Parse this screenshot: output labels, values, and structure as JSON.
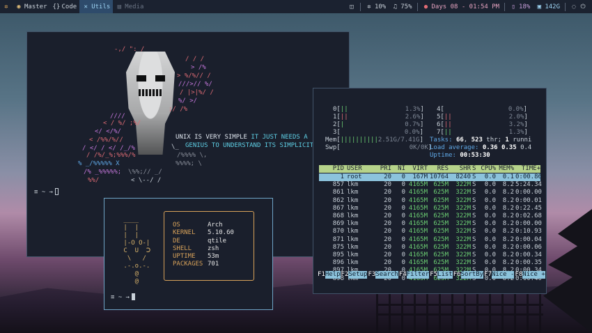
{
  "bar": {
    "workspaces": [
      {
        "icon": "compass-icon",
        "label": "Master",
        "active": false
      },
      {
        "icon": "code-braces-icon",
        "label": "Code",
        "active": false
      },
      {
        "icon": "wrench-icon",
        "label": "Utils",
        "active": true
      },
      {
        "icon": "film-icon",
        "label": "Media",
        "active": false
      }
    ],
    "cpu": "10%",
    "volume": "75%",
    "clock": "Days 08 - 01:54 PM",
    "mem": "18%",
    "disk": "142G"
  },
  "term1": {
    "quote_white1": "UNIX IS VERY SIMPLE",
    "quote_cyan1": "IT JUST NEEDS A",
    "quote_cyan2": "GENIUS TO UNDERSTAND ITS SIMPLICITY",
    "prompt": "≡ ~ →"
  },
  "fetch": {
    "rows": [
      {
        "key": "OS",
        "value": "Arch"
      },
      {
        "key": "KERNEL",
        "value": "5.10.60"
      },
      {
        "key": "DE",
        "value": "qtile"
      },
      {
        "key": "SHELL",
        "value": "zsh"
      },
      {
        "key": "UPTIME",
        "value": "53m"
      },
      {
        "key": "PACKAGES",
        "value": "701"
      }
    ],
    "prompt": "≡ ~ →"
  },
  "htop": {
    "cpus_left": [
      {
        "id": "0",
        "bar": "||",
        "pct": "1.3%"
      },
      {
        "id": "1",
        "bar": "||",
        "pct": "2.6%"
      },
      {
        "id": "2",
        "bar": "|",
        "pct": "0.7%"
      },
      {
        "id": "3",
        "bar": "",
        "pct": "0.0%"
      }
    ],
    "cpus_right": [
      {
        "id": "4",
        "bar": "",
        "pct": "0.0%"
      },
      {
        "id": "5",
        "bar": "||",
        "pct": "2.0%"
      },
      {
        "id": "6",
        "bar": "||",
        "pct": "3.2%"
      },
      {
        "id": "7",
        "bar": "||",
        "pct": "1.3%"
      }
    ],
    "mem_label": "Mem",
    "mem_bar": "||||||||||",
    "mem_value": "2.51G/7.41G",
    "swp_label": "Swp",
    "swp_value": "0K/0K",
    "tasks_label": "Tasks:",
    "tasks": "66",
    "thr": "523",
    "running": "1",
    "load_label": "Load average:",
    "load1": "0.36",
    "load5": "0.35",
    "load15": "0.4",
    "uptime_label": "Uptime:",
    "uptime": "00:53:30",
    "header": [
      "PID",
      "USER",
      "PRI",
      "NI",
      "VIRT",
      "RES",
      "SHR",
      "S",
      "CPU%",
      "MEM%",
      "TIME+"
    ],
    "processes": [
      {
        "pid": "1",
        "user": "root",
        "pri": "20",
        "ni": "0",
        "virt": "167M",
        "res": "10764",
        "shr": "8240",
        "s": "S",
        "cpu": "0.0",
        "mem": "0.1",
        "time": "0:00.86"
      },
      {
        "pid": "857",
        "user": "lkm",
        "pri": "20",
        "ni": "0",
        "virt": "4165M",
        "res": "625M",
        "shr": "322M",
        "s": "S",
        "cpu": "0.0",
        "mem": "8.2",
        "time": "5:24.34"
      },
      {
        "pid": "861",
        "user": "lkm",
        "pri": "20",
        "ni": "0",
        "virt": "4165M",
        "res": "625M",
        "shr": "322M",
        "s": "S",
        "cpu": "0.0",
        "mem": "8.2",
        "time": "0:00.00"
      },
      {
        "pid": "862",
        "user": "lkm",
        "pri": "20",
        "ni": "0",
        "virt": "4165M",
        "res": "625M",
        "shr": "322M",
        "s": "S",
        "cpu": "0.0",
        "mem": "8.2",
        "time": "0:00.01"
      },
      {
        "pid": "867",
        "user": "lkm",
        "pri": "20",
        "ni": "0",
        "virt": "4165M",
        "res": "625M",
        "shr": "322M",
        "s": "S",
        "cpu": "0.0",
        "mem": "8.2",
        "time": "0:22.45"
      },
      {
        "pid": "868",
        "user": "lkm",
        "pri": "20",
        "ni": "0",
        "virt": "4165M",
        "res": "625M",
        "shr": "322M",
        "s": "S",
        "cpu": "0.0",
        "mem": "8.2",
        "time": "0:02.68"
      },
      {
        "pid": "869",
        "user": "lkm",
        "pri": "20",
        "ni": "0",
        "virt": "4165M",
        "res": "625M",
        "shr": "322M",
        "s": "S",
        "cpu": "0.0",
        "mem": "8.2",
        "time": "0:00.00"
      },
      {
        "pid": "870",
        "user": "lkm",
        "pri": "20",
        "ni": "0",
        "virt": "4165M",
        "res": "625M",
        "shr": "322M",
        "s": "S",
        "cpu": "0.0",
        "mem": "8.2",
        "time": "0:10.93"
      },
      {
        "pid": "871",
        "user": "lkm",
        "pri": "20",
        "ni": "0",
        "virt": "4165M",
        "res": "625M",
        "shr": "322M",
        "s": "S",
        "cpu": "0.0",
        "mem": "8.2",
        "time": "0:00.04"
      },
      {
        "pid": "875",
        "user": "lkm",
        "pri": "20",
        "ni": "0",
        "virt": "4165M",
        "res": "625M",
        "shr": "322M",
        "s": "S",
        "cpu": "0.0",
        "mem": "8.2",
        "time": "0:00.06"
      },
      {
        "pid": "895",
        "user": "lkm",
        "pri": "20",
        "ni": "0",
        "virt": "4165M",
        "res": "625M",
        "shr": "322M",
        "s": "S",
        "cpu": "0.0",
        "mem": "8.2",
        "time": "0:00.34"
      },
      {
        "pid": "896",
        "user": "lkm",
        "pri": "20",
        "ni": "0",
        "virt": "4165M",
        "res": "625M",
        "shr": "322M",
        "s": "S",
        "cpu": "0.0",
        "mem": "8.2",
        "time": "0:00.35"
      },
      {
        "pid": "897",
        "user": "lkm",
        "pri": "20",
        "ni": "0",
        "virt": "4165M",
        "res": "625M",
        "shr": "322M",
        "s": "S",
        "cpu": "0.0",
        "mem": "8.2",
        "time": "0:00.34"
      },
      {
        "pid": "898",
        "user": "lkm",
        "pri": "20",
        "ni": "0",
        "virt": "4165M",
        "res": "625M",
        "shr": "322M",
        "s": "S",
        "cpu": "0.0",
        "mem": "8.2",
        "time": "0:00.40"
      }
    ],
    "fkeys": [
      {
        "key": "F1",
        "label": "Help  "
      },
      {
        "key": "F2",
        "label": "Setup "
      },
      {
        "key": "F3",
        "label": "Search"
      },
      {
        "key": "F4",
        "label": "Filter"
      },
      {
        "key": "F5",
        "label": "List  "
      },
      {
        "key": "F6",
        "label": "SortBy"
      },
      {
        "key": "F7",
        "label": "Nice -"
      },
      {
        "key": "F8",
        "label": "Nice +"
      }
    ]
  }
}
